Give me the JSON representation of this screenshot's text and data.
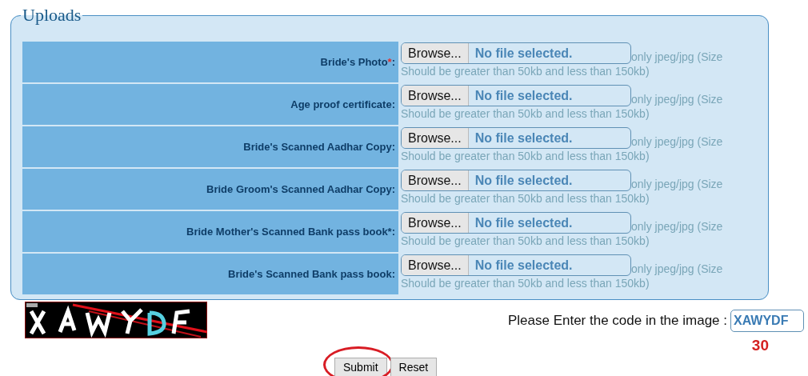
{
  "uploads": {
    "legend": "Uploads",
    "rows": [
      {
        "label": "Bride's Photo",
        "asterisk": "*",
        "suffix": ":",
        "button": "Browse...",
        "status": "No file selected.",
        "hint": "only jpeg/jpg (Size",
        "hint_continued": "Should be greater than 50kb and less than 150kb)"
      },
      {
        "label": "Age proof certificate:",
        "button": "Browse...",
        "status": "No file selected.",
        "hint": "only jpeg/jpg (Size",
        "hint_continued": "Should be greater than 50kb and less than 150kb)"
      },
      {
        "label": "Bride's Scanned Aadhar Copy:",
        "button": "Browse...",
        "status": "No file selected.",
        "hint": "only jpeg/jpg (Size",
        "hint_continued": "Should be greater than 50kb and less than 150kb)"
      },
      {
        "label": "Bride Groom's Scanned Aadhar Copy:",
        "button": "Browse...",
        "status": "No file selected.",
        "hint": "only jpeg/jpg (Size",
        "hint_continued": "Should be greater than 50kb and less than 150kb)"
      },
      {
        "label": "Bride Mother's Scanned Bank pass book*:",
        "button": "Browse...",
        "status": "No file selected.",
        "hint": "only jpeg/jpg (Size",
        "hint_continued": "Should be greater than 50kb and less than 150kb)"
      },
      {
        "label": "Bride's Scanned Bank pass book:",
        "button": "Browse...",
        "status": "No file selected.",
        "hint": "only jpeg/jpg (Size",
        "hint_continued": "Should be greater than 50kb and less than 150kb)"
      }
    ]
  },
  "captcha": {
    "prompt": "Please Enter the code in the image :",
    "value": "XAWYDF",
    "countdown": "30"
  },
  "buttons": [
    {
      "label": "Submit",
      "highlighted": true
    },
    {
      "label": "Reset",
      "highlighted": false
    }
  ]
}
